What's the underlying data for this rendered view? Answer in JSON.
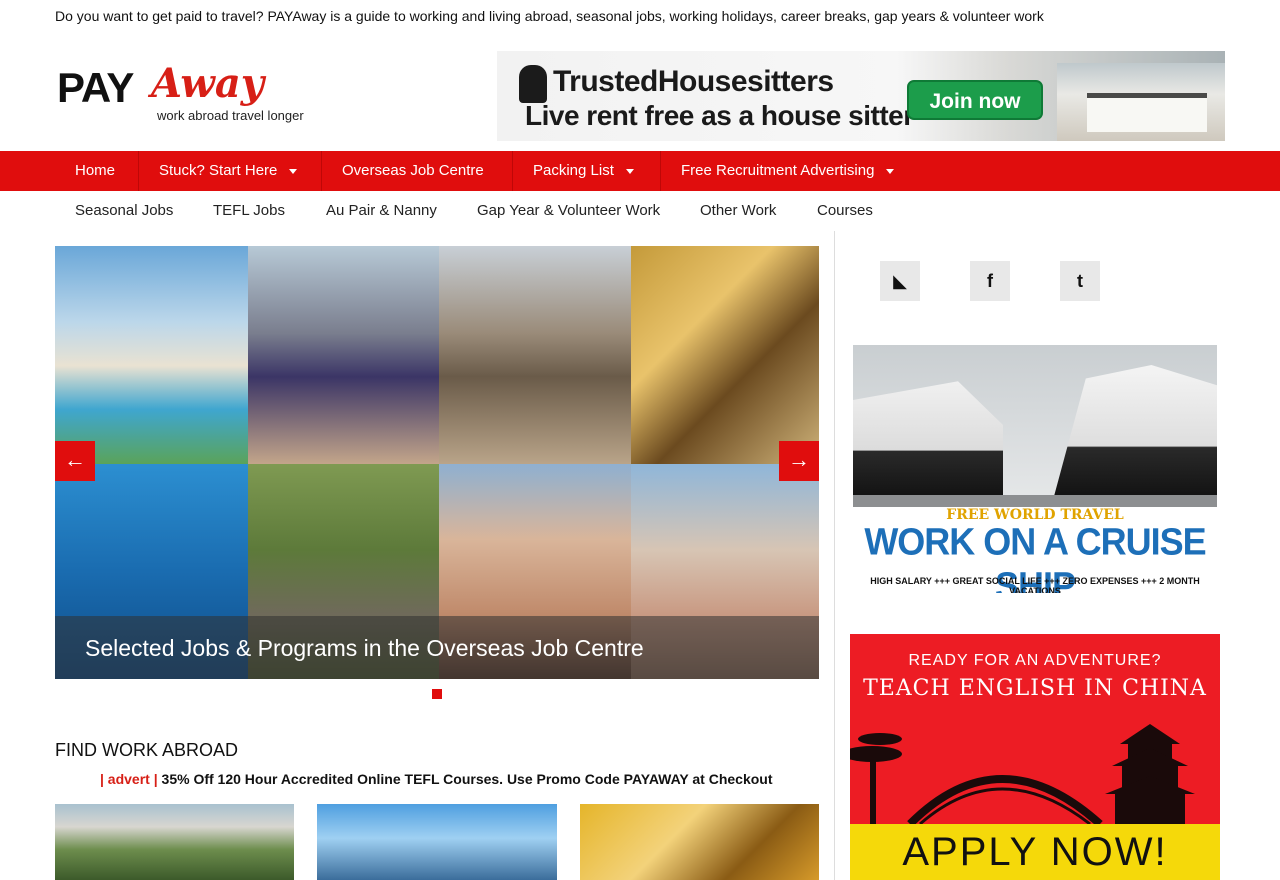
{
  "tagline": "Do you want to get paid to travel? PAYAway is a guide to working and living abroad, seasonal jobs, working holidays, career breaks, gap years & volunteer work",
  "logo": {
    "pay": "PAY",
    "away": "Away",
    "subtitle": "work abroad travel longer"
  },
  "ad_top": {
    "brand": "TrustedHousesitters",
    "headline": "Live rent free as a house sitter",
    "button": "Join now"
  },
  "nav_primary": [
    {
      "label": "Home"
    },
    {
      "label": "Stuck? Start Here"
    },
    {
      "label": "Overseas Job Centre"
    },
    {
      "label": "Packing List"
    },
    {
      "label": "Free Recruitment Advertising"
    }
  ],
  "nav_secondary": [
    {
      "label": "Seasonal Jobs"
    },
    {
      "label": "TEFL Jobs"
    },
    {
      "label": "Au Pair & Nanny"
    },
    {
      "label": "Gap Year & Volunteer Work"
    },
    {
      "label": "Other Work"
    },
    {
      "label": "Courses"
    }
  ],
  "slider": {
    "caption": "Selected Jobs & Programs in the Overseas Job Centre",
    "prev": "←",
    "next": "→"
  },
  "main": {
    "section_title": "FIND WORK ABROAD",
    "promo_prefix": "| advert |",
    "promo_link": "35% Off 120 Hour Accredited Online TEFL Courses. Use Promo Code PAYAWAY at Checkout"
  },
  "social": [
    {
      "icon": "rss-icon",
      "glyph": "◣"
    },
    {
      "icon": "facebook-icon",
      "glyph": "f"
    },
    {
      "icon": "twitter-icon",
      "glyph": "t"
    }
  ],
  "ad_cruise": {
    "line1": "FREE WORLD TRAVEL",
    "line2": "WORK ON A CRUISE SHIP",
    "line3": "HIGH SALARY +++ GREAT SOCIAL LIFE +++ ZERO EXPENSES +++ 2 MONTH VACATIONS"
  },
  "ad_china": {
    "line1": "READY FOR AN ADVENTURE?",
    "line2": "TEACH ENGLISH IN CHINA",
    "apply": "APPLY NOW!"
  },
  "colors": {
    "brand_red": "#e00d0d",
    "logo_red": "#d71f16"
  }
}
